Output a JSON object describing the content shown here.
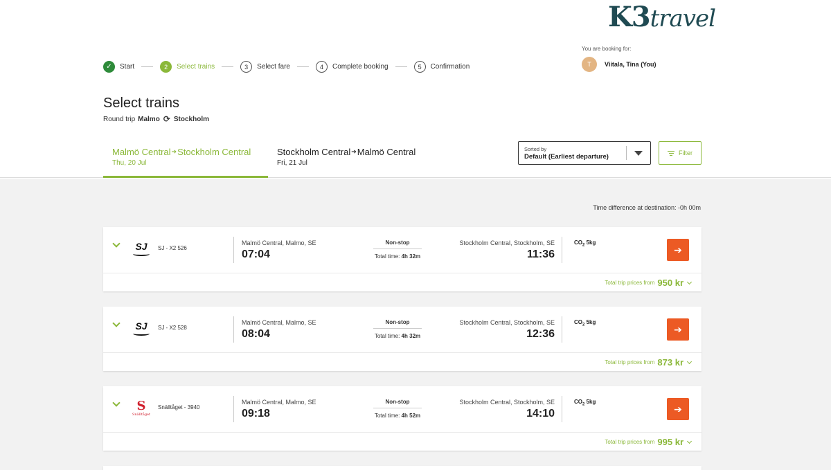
{
  "brand": {
    "logo_main": "K3",
    "logo_script": "travel"
  },
  "stepper": [
    {
      "num": "✓",
      "label": "Start",
      "state": "done"
    },
    {
      "num": "2",
      "label": "Select trains",
      "state": "active"
    },
    {
      "num": "3",
      "label": "Select fare",
      "state": "todo"
    },
    {
      "num": "4",
      "label": "Complete booking",
      "state": "todo"
    },
    {
      "num": "5",
      "label": "Confirmation",
      "state": "todo"
    }
  ],
  "booking": {
    "label": "You are booking for:",
    "initial": "T",
    "name": "Viitala, Tina (You)"
  },
  "page": {
    "title": "Select trains",
    "trip_type": "Round trip",
    "origin": "Malmo",
    "destination": "Stockholm"
  },
  "tabs": [
    {
      "from": "Malmö Central",
      "to": "Stockholm Central",
      "date": "Thu, 20 Jul"
    },
    {
      "from": "Stockholm Central",
      "to": "Malmö Central",
      "date": "Fri, 21 Jul"
    }
  ],
  "sort": {
    "label": "Sorted by",
    "value": "Default (Earliest departure)"
  },
  "filter": {
    "label": "Filter"
  },
  "time_difference": "Time difference at destination: -0h 00m",
  "colors": {
    "accent": "#8bb83a",
    "action": "#ec5a24",
    "done": "#2e8b3a"
  },
  "trains": [
    {
      "operator": "SJ",
      "logo": "sj-logo-icon",
      "name": "SJ - X2 526",
      "dep_station": "Malmö Central, Malmo, SE",
      "dep_time": "07:04",
      "stops": "Non-stop",
      "total_label": "Total time:",
      "duration": "4h 32m",
      "arr_station": "Stockholm Central, Stockholm, SE",
      "arr_time": "11:36",
      "co2_label": "CO",
      "co2_sub": "2",
      "co2_value": "5kg",
      "price_label": "Total trip prices from",
      "price": "950 kr"
    },
    {
      "operator": "SJ",
      "logo": "sj-logo-icon",
      "name": "SJ - X2 528",
      "dep_station": "Malmö Central, Malmo, SE",
      "dep_time": "08:04",
      "stops": "Non-stop",
      "total_label": "Total time:",
      "duration": "4h 32m",
      "arr_station": "Stockholm Central, Stockholm, SE",
      "arr_time": "12:36",
      "co2_label": "CO",
      "co2_sub": "2",
      "co2_value": "5kg",
      "price_label": "Total trip prices from",
      "price": "873 kr"
    },
    {
      "operator": "S",
      "logo": "snalltaget-logo-icon",
      "logo_small": "Snälltåget",
      "name": "Snälltåget - 3940",
      "dep_station": "Malmö Central, Malmo, SE",
      "dep_time": "09:18",
      "stops": "Non-stop",
      "total_label": "Total time:",
      "duration": "4h 52m",
      "arr_station": "Stockholm Central, Stockholm, SE",
      "arr_time": "14:10",
      "co2_label": "CO",
      "co2_sub": "2",
      "co2_value": "5kg",
      "price_label": "Total trip prices from",
      "price": "995 kr"
    }
  ]
}
